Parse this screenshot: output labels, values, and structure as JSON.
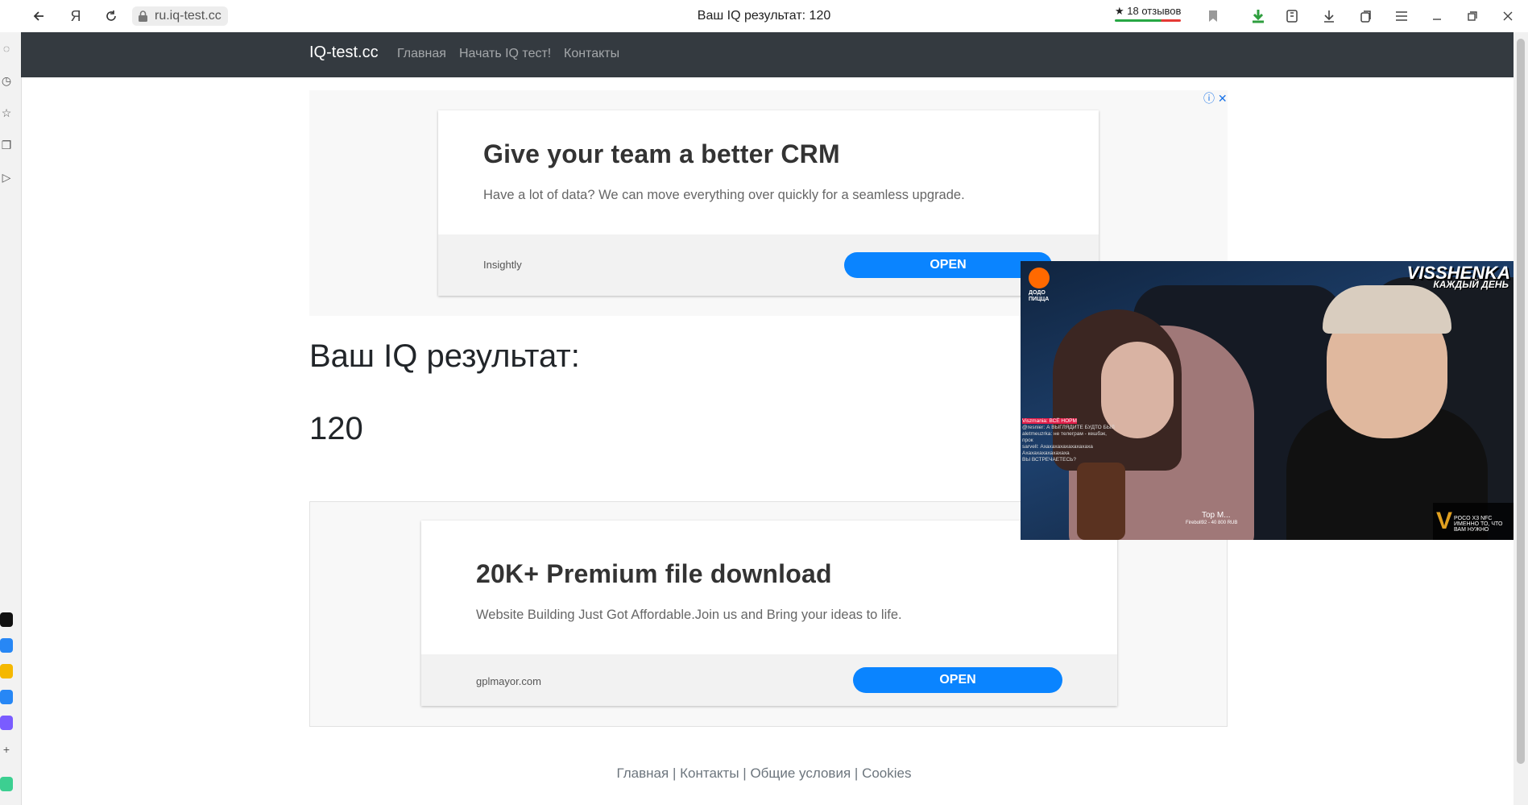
{
  "browser": {
    "tab_title": "Ваш IQ результат: 120",
    "url": "ru.iq-test.cc",
    "reviews": "★ 18 отзывов",
    "yandex_glyph": "Я"
  },
  "site": {
    "brand": "IQ-test.cc",
    "nav": [
      "Главная",
      "Начать IQ тест!",
      "Контакты"
    ]
  },
  "ad_top": {
    "headline": "Give your team a better CRM",
    "text": "Have a lot of data? We can move everything over quickly for a seamless upgrade.",
    "advertiser": "Insightly",
    "button": "OPEN"
  },
  "result": {
    "title": "Ваш IQ результат:",
    "score": "120"
  },
  "ad_bottom": {
    "headline": "20K+ Premium file download",
    "text": "Website Building Just Got Affordable.Join us and Bring your ideas to life.",
    "advertiser": "gplmayor.com",
    "button": "OPEN"
  },
  "footer": {
    "links": [
      "Главная",
      "Контакты",
      "Общие условия",
      "Cookies"
    ],
    "separator": "|"
  },
  "video": {
    "brand": "ДОДО ПИЦЦА",
    "logo_line1": "VISSHENKA",
    "logo_line2": "КАЖДЫЙ ДЕНЬ",
    "chat": [
      "Viszmania: ВСЁ НОРМ",
      "@resnier: А ВЫГЛЯДИТЕ БУДТО БЫЛ",
      "aletmeuzrka: не телеграм - кешбэк, прок",
      "sarvell: Ахахахахахахахахаха",
      "Ахахахахахахахаха",
      "ВЫ ВСТРЕЧАЕТЕСЬ?"
    ],
    "top_label": "Top M...",
    "donation": "Fireboll92 - 40 800 RUB",
    "sponsor": "POCO X3 NFC",
    "sponsor_sub": "ИМЕННО ТО, ЧТО ВАМ НУЖНО"
  },
  "colors": {
    "navbar": "#343a40",
    "ad_button": "#0a84ff"
  }
}
